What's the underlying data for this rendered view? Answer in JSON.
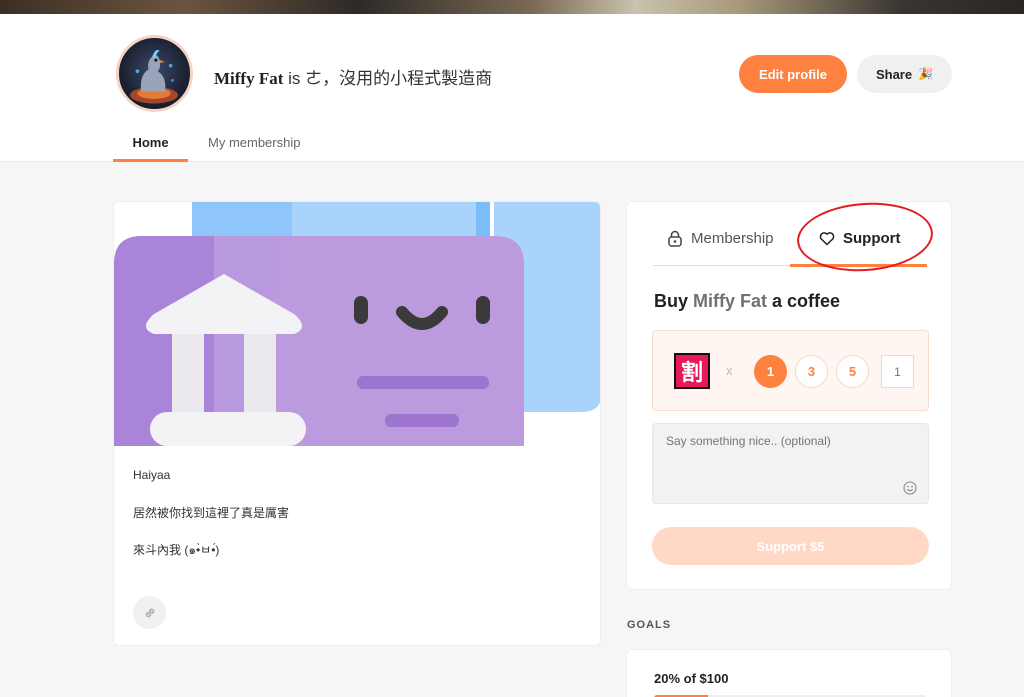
{
  "profile": {
    "name": "Miffy Fat",
    "tagline": " is ㄜ，沒用的小程式製造商",
    "edit_label": "Edit profile",
    "share_label": "Share",
    "share_icon": "🎉"
  },
  "nav": {
    "tabs": [
      {
        "label": "Home",
        "active": true
      },
      {
        "label": "My membership",
        "active": false
      }
    ]
  },
  "post": {
    "lines": [
      "Haiyaa",
      "居然被你找到這裡了真是厲害",
      "來斗內我 (๑•̀ㅂ•́)"
    ]
  },
  "support_panel": {
    "tabs": [
      {
        "label": "Membership",
        "icon": "lock-icon"
      },
      {
        "label": "Support",
        "icon": "heart-icon",
        "active": true
      }
    ],
    "buy_prefix": "Buy ",
    "buy_name": "Miffy Fat",
    "buy_suffix": " a coffee",
    "coffee_icon_text": "割",
    "x_label": "x",
    "quantities": [
      "1",
      "3",
      "5"
    ],
    "selected_quantity": "1",
    "custom_quantity_placeholder": "1",
    "message_placeholder": "Say something nice.. (optional)",
    "support_button": "Support $5"
  },
  "goals": {
    "label": "GOALS",
    "progress_text": "20% of $100",
    "progress_fraction": 0.2
  },
  "colors": {
    "accent": "#ff813f",
    "annotation": "#e31b23"
  }
}
